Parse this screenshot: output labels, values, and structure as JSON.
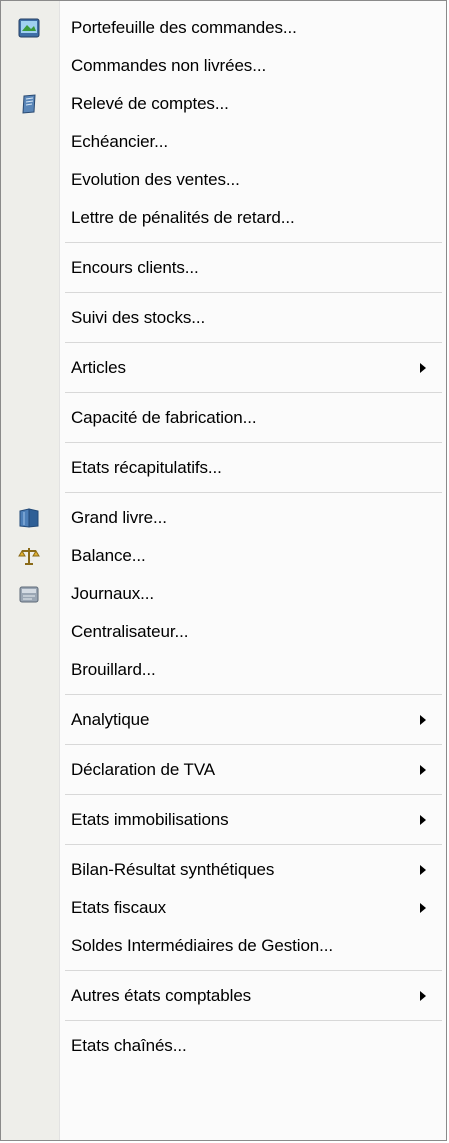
{
  "menu": {
    "items": [
      {
        "label": "Portefeuille des commandes...",
        "submenu": false,
        "icon": "portfolio-icon"
      },
      {
        "label": "Commandes non livrées...",
        "submenu": false,
        "icon": null
      },
      {
        "label": "Relevé de comptes...",
        "submenu": false,
        "icon": "statement-icon"
      },
      {
        "label": "Echéancier...",
        "submenu": false,
        "icon": null
      },
      {
        "label": "Evolution des ventes...",
        "submenu": false,
        "icon": null
      },
      {
        "label": "Lettre de pénalités de retard...",
        "submenu": false,
        "icon": null
      },
      {
        "label": "Encours clients...",
        "submenu": false,
        "icon": null
      },
      {
        "label": "Suivi des stocks...",
        "submenu": false,
        "icon": null
      },
      {
        "label": "Articles",
        "submenu": true,
        "icon": null
      },
      {
        "label": "Capacité de fabrication...",
        "submenu": false,
        "icon": null
      },
      {
        "label": "Etats récapitulatifs...",
        "submenu": false,
        "icon": null
      },
      {
        "label": "Grand livre...",
        "submenu": false,
        "icon": "ledger-icon"
      },
      {
        "label": "Balance...",
        "submenu": false,
        "icon": "scales-icon"
      },
      {
        "label": "Journaux...",
        "submenu": false,
        "icon": "journal-icon"
      },
      {
        "label": "Centralisateur...",
        "submenu": false,
        "icon": null
      },
      {
        "label": "Brouillard...",
        "submenu": false,
        "icon": null
      },
      {
        "label": "Analytique",
        "submenu": true,
        "icon": null
      },
      {
        "label": "Déclaration de TVA",
        "submenu": true,
        "icon": null
      },
      {
        "label": "Etats immobilisations",
        "submenu": true,
        "icon": null
      },
      {
        "label": "Bilan-Résultat synthétiques",
        "submenu": true,
        "icon": null
      },
      {
        "label": "Etats fiscaux",
        "submenu": true,
        "icon": null
      },
      {
        "label": "Soldes Intermédiaires de Gestion...",
        "submenu": false,
        "icon": null
      },
      {
        "label": "Autres états comptables",
        "submenu": true,
        "icon": null
      },
      {
        "label": "Etats chaînés...",
        "submenu": false,
        "icon": null
      }
    ]
  }
}
